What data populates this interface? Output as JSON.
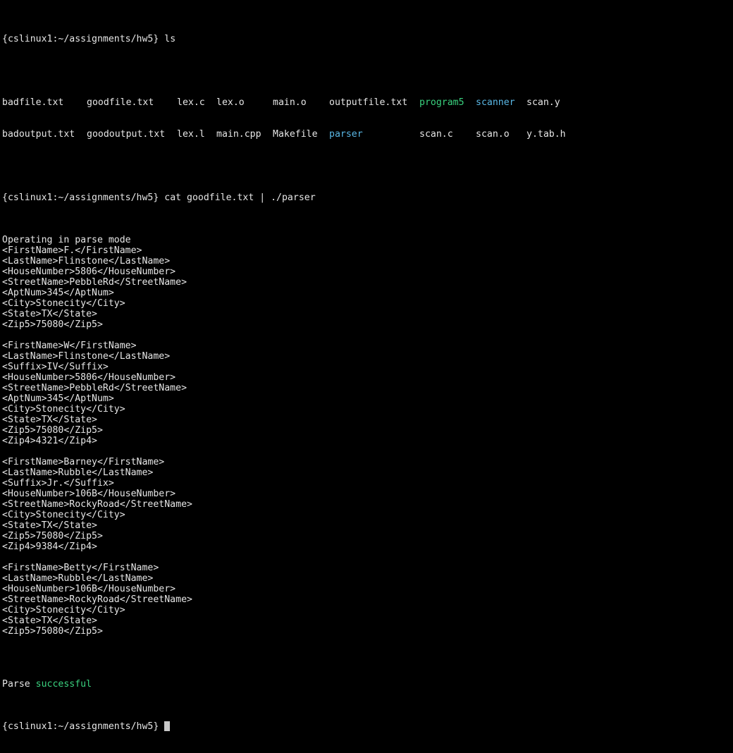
{
  "prompt": "{cslinux1:~/assignments/hw5}",
  "cmd_ls": "ls",
  "ls_rows": [
    [
      "badfile.txt",
      "goodfile.txt",
      "lex.c",
      "lex.o",
      "main.o",
      "outputfile.txt",
      "program5",
      "scanner",
      "scan.y"
    ],
    [
      "badoutput.txt",
      "goodoutput.txt",
      "lex.l",
      "main.cpp",
      "Makefile",
      "parser",
      "scan.c",
      "scan.o",
      "y.tab.h"
    ]
  ],
  "colors": {
    "background": "#000000",
    "text": "#e6e6e6",
    "executable": "#3ad27f",
    "directory": "#5ab8e6",
    "success": "#3ad27f"
  },
  "cmd_parse": "cat goodfile.txt | ./parser",
  "output": [
    "Operating in parse mode",
    "<FirstName>F.</FirstName>",
    "<LastName>Flinstone</LastName>",
    "<HouseNumber>5806</HouseNumber>",
    "<StreetName>PebbleRd</StreetName>",
    "<AptNum>345</AptNum>",
    "<City>Stonecity</City>",
    "<State>TX</State>",
    "<Zip5>75080</Zip5>",
    "",
    "<FirstName>W</FirstName>",
    "<LastName>Flinstone</LastName>",
    "<Suffix>IV</Suffix>",
    "<HouseNumber>5806</HouseNumber>",
    "<StreetName>PebbleRd</StreetName>",
    "<AptNum>345</AptNum>",
    "<City>Stonecity</City>",
    "<State>TX</State>",
    "<Zip5>75080</Zip5>",
    "<Zip4>4321</Zip4>",
    "",
    "<FirstName>Barney</FirstName>",
    "<LastName>Rubble</LastName>",
    "<Suffix>Jr.</Suffix>",
    "<HouseNumber>106B</HouseNumber>",
    "<StreetName>RockyRoad</StreetName>",
    "<City>Stonecity</City>",
    "<State>TX</State>",
    "<Zip5>75080</Zip5>",
    "<Zip4>9384</Zip4>",
    "",
    "<FirstName>Betty</FirstName>",
    "<LastName>Rubble</LastName>",
    "<HouseNumber>106B</HouseNumber>",
    "<StreetName>RockyRoad</StreetName>",
    "<City>Stonecity</City>",
    "<State>TX</State>",
    "<Zip5>75080</Zip5>",
    ""
  ],
  "status_prefix": "Parse",
  "status_word": "successful"
}
